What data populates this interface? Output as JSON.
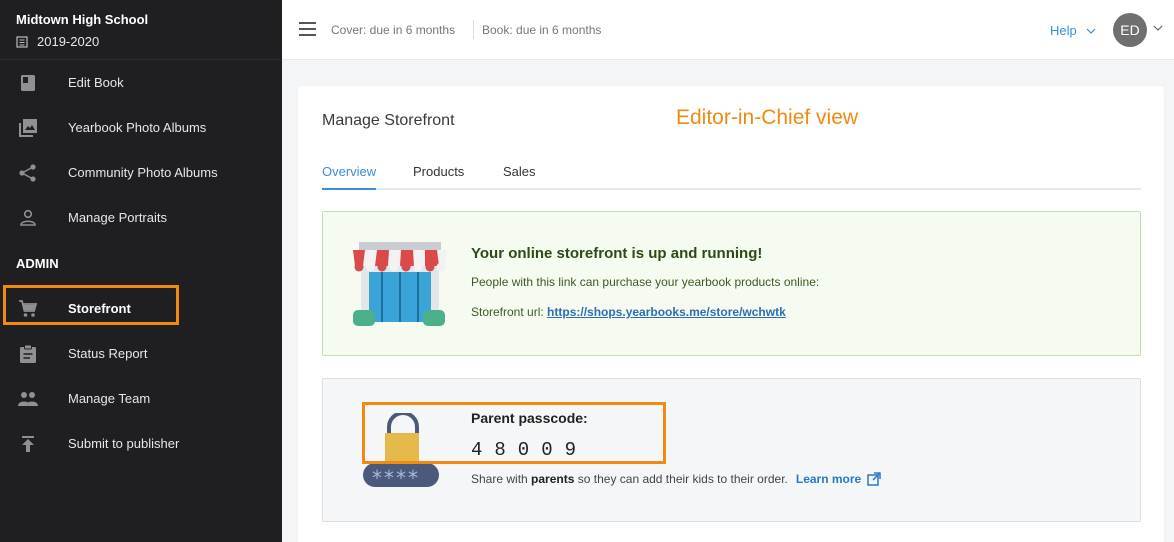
{
  "sidebar": {
    "school_name": "Midtown High School",
    "school_year": "2019-2020",
    "items": [
      {
        "label": "Edit Book",
        "icon": "book-icon"
      },
      {
        "label": "Yearbook Photo Albums",
        "icon": "photo-album-icon"
      },
      {
        "label": "Community Photo Albums",
        "icon": "share-icon"
      },
      {
        "label": "Manage Portraits",
        "icon": "person-icon"
      },
      {
        "label": "Storefront",
        "icon": "cart-icon"
      },
      {
        "label": "Status Report",
        "icon": "clipboard-icon"
      },
      {
        "label": "Manage Team",
        "icon": "team-icon"
      },
      {
        "label": "Submit to publisher",
        "icon": "upload-icon"
      }
    ],
    "admin_heading": "ADMIN",
    "highlight_color": "#f08a12"
  },
  "topbar": {
    "cover_due": "Cover: due in 6 months",
    "book_due": "Book: due in 6 months",
    "help_label": "Help",
    "avatar_initials": "ED"
  },
  "main": {
    "title": "Manage Storefront",
    "annotation": "Editor-in-Chief view",
    "tabs": [
      {
        "label": "Overview",
        "active": true
      },
      {
        "label": "Products",
        "active": false
      },
      {
        "label": "Sales",
        "active": false
      }
    ],
    "storefront": {
      "heading": "Your online storefront is up and running!",
      "description": "People with this link can purchase your yearbook products online:",
      "url_label": "Storefront url:",
      "url": "https://shops.yearbooks.me/store/wchwtk"
    },
    "passcode": {
      "label": "Parent passcode:",
      "digits": "48009",
      "share_prefix": "Share with",
      "share_bold": "parents",
      "share_suffix": "so they can add their kids to their order.",
      "learn_more": "Learn more",
      "mask": "****"
    }
  },
  "colors": {
    "accent": "#3a8ed8",
    "highlight": "#f08a12",
    "sidebar_bg": "#1f1f22"
  }
}
